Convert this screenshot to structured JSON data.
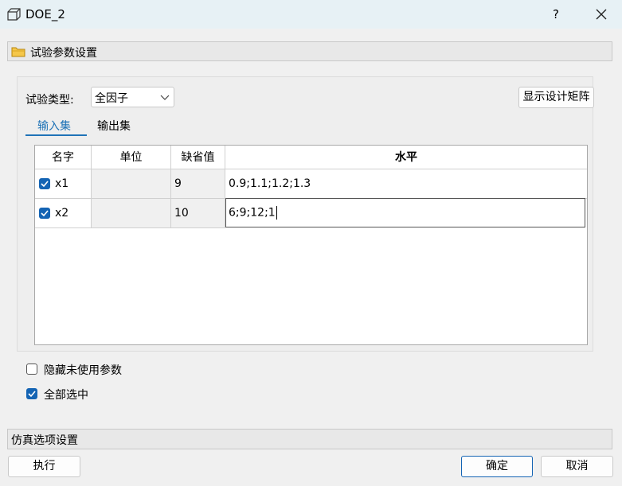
{
  "window": {
    "title": "DOE_2",
    "help": "?"
  },
  "sections": {
    "experiment": "试验参数设置",
    "simulation": "仿真选项设置"
  },
  "experiment_type": {
    "label": "试验类型:",
    "value": "全因子"
  },
  "show_matrix_button": "显示设计矩阵",
  "tabs": [
    {
      "label": "输入集",
      "active": true
    },
    {
      "label": "输出集",
      "active": false
    }
  ],
  "table": {
    "headers": [
      "名字",
      "单位",
      "缺省值",
      "水平"
    ],
    "rows": [
      {
        "checked": true,
        "name": "x1",
        "unit": "",
        "default": "9",
        "level": "0.9;1.1;1.2;1.3"
      },
      {
        "checked": true,
        "name": "x2",
        "unit": "",
        "default": "10",
        "level": "6;9;12;1"
      }
    ]
  },
  "options": {
    "hide_unused": {
      "label": "隐藏未使用参数",
      "checked": false
    },
    "select_all": {
      "label": "全部选中",
      "checked": true
    }
  },
  "buttons": {
    "run": "执行",
    "ok": "确定",
    "cancel": "取消"
  },
  "colors": {
    "accent": "#1464b4",
    "titlebar": "#e7f1f5"
  }
}
